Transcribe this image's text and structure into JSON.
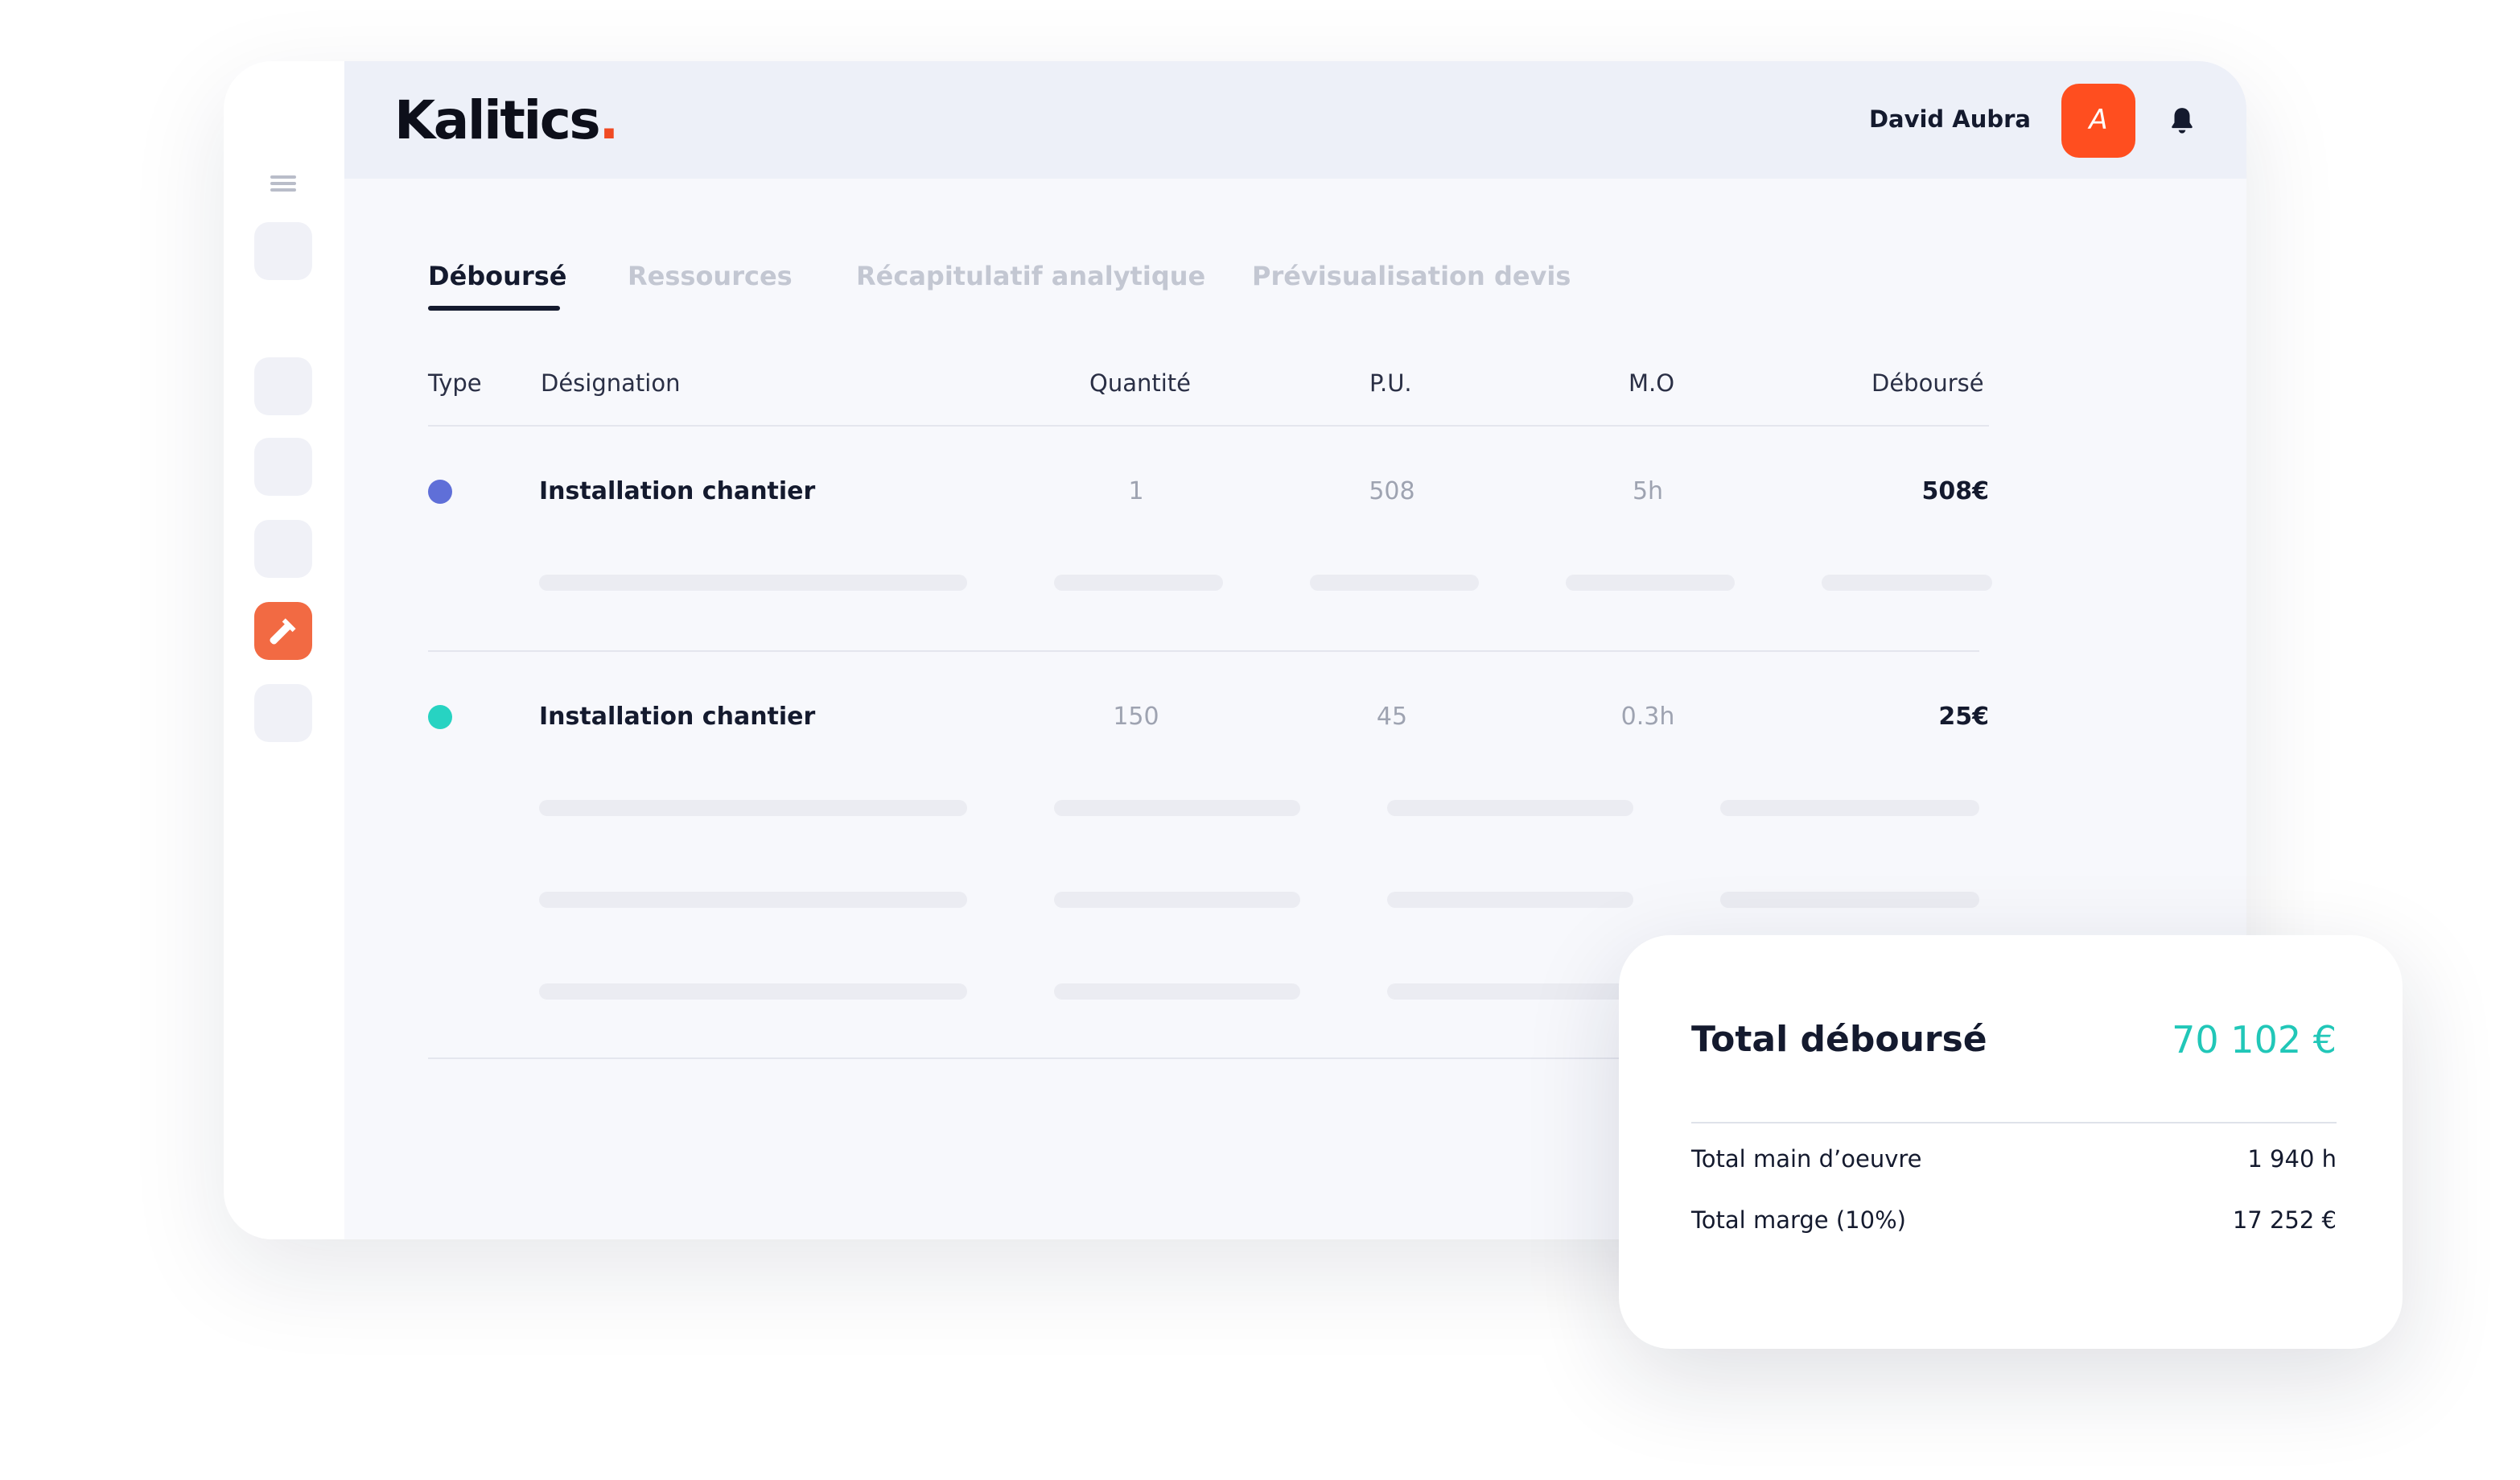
{
  "header": {
    "logo_text": "Kalitics",
    "logo_dot": ".",
    "user_name": "David Aubra",
    "avatar_initial": "A",
    "icons": [
      "menu-icon",
      "hammer-icon",
      "bell-icon"
    ]
  },
  "tabs": [
    {
      "label": "Déboursé",
      "active": true
    },
    {
      "label": "Ressources",
      "active": false
    },
    {
      "label": "Récapitulatif analytique",
      "active": false
    },
    {
      "label": "Prévisualisation devis",
      "active": false
    }
  ],
  "table": {
    "columns": [
      "Type",
      "Désignation",
      "Quantité",
      "P.U.",
      "M.O",
      "Déboursé"
    ],
    "rows": [
      {
        "type_color": "#5f6fd8",
        "designation": "Installation chantier",
        "quantite": "1",
        "pu": "508",
        "mo": "5h",
        "debourse": "508€"
      },
      {
        "type_color": "#27d3c2",
        "designation": "Installation chantier",
        "quantite": "150",
        "pu": "45",
        "mo": "0.3h",
        "debourse": "25€"
      }
    ]
  },
  "summary": {
    "title": "Total déboursé",
    "total": "70 102 €",
    "rows": [
      {
        "label": "Total main d’oeuvre",
        "value": "1 940 h"
      },
      {
        "label": "Total marge (10%)",
        "value": "17 252 €"
      }
    ]
  },
  "colors": {
    "accent": "#ff4e1f",
    "sidebar_active": "#f26a43",
    "total_teal": "#21c7b8"
  }
}
